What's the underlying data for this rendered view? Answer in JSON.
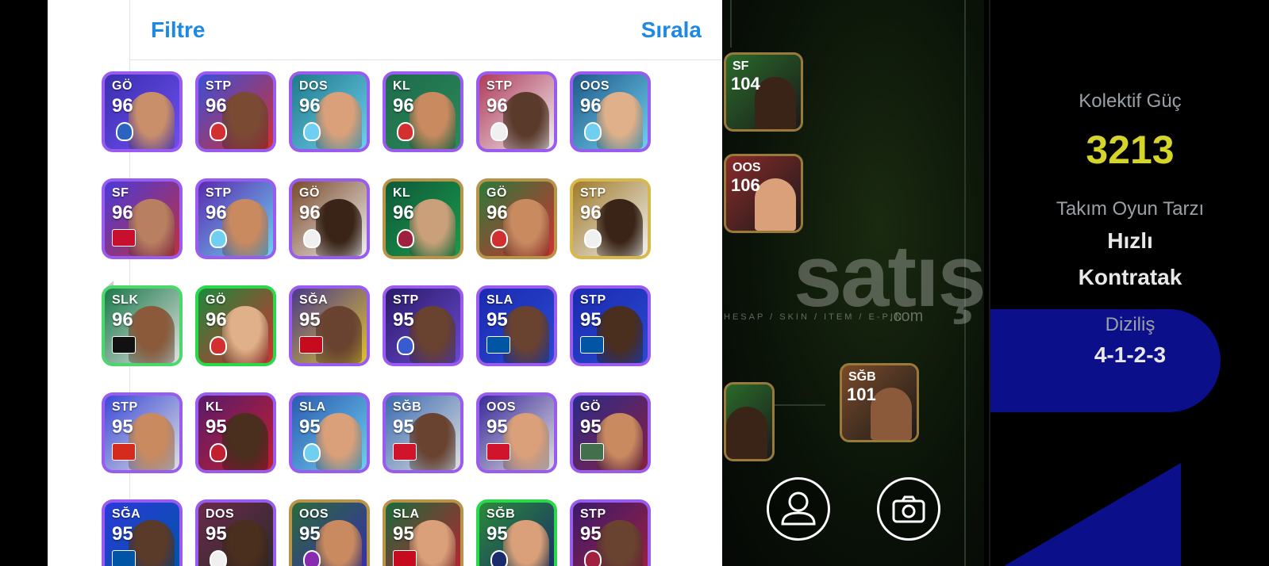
{
  "header": {
    "filter_label": "Filtre",
    "sort_label": "Sırala"
  },
  "cards": [
    {
      "pos": "GÖ",
      "rating": "96",
      "border": "#9a5cf0",
      "bg": "#3a2fb0",
      "accent": "#6f4ff0",
      "face": "#c98f6a",
      "badge": "club",
      "badge_color": "#2a64c0"
    },
    {
      "pos": "STP",
      "rating": "96",
      "border": "#9a5cf0",
      "bg": "#3b4fd8",
      "accent": "#d23030",
      "face": "#7a4a32",
      "badge": "club",
      "badge_color": "#d23030"
    },
    {
      "pos": "DOS",
      "rating": "96",
      "border": "#9a5cf0",
      "bg": "#1e7a8a",
      "accent": "#6fcff0",
      "face": "#d9a07a",
      "badge": "club",
      "badge_color": "#6fcff0"
    },
    {
      "pos": "KL",
      "rating": "96",
      "border": "#9a5cf0",
      "bg": "#1e6a4a",
      "accent": "#2a8a5a",
      "face": "#c98a60",
      "badge": "club",
      "badge_color": "#d23030"
    },
    {
      "pos": "STP",
      "rating": "96",
      "border": "#9a5cf0",
      "bg": "#b03a5a",
      "accent": "#f0f0f0",
      "face": "#5a3a2a",
      "badge": "club",
      "badge_color": "#f0f0f0"
    },
    {
      "pos": "OOS",
      "rating": "96",
      "border": "#9a5cf0",
      "bg": "#1e5a8a",
      "accent": "#6fcff0",
      "face": "#e0b08a",
      "badge": "club",
      "badge_color": "#6fcff0"
    },
    {
      "pos": "SF",
      "rating": "96",
      "border": "#9a5cf0",
      "bg": "#4a3ad8",
      "accent": "#c03040",
      "face": "#b88060",
      "badge": "flag",
      "badge_color": "#c8102e"
    },
    {
      "pos": "STP",
      "rating": "96",
      "border": "#9a5cf0",
      "bg": "#5a2ab0",
      "accent": "#6fcff0",
      "face": "#c98a60",
      "badge": "club",
      "badge_color": "#6fcff0"
    },
    {
      "pos": "GÖ",
      "rating": "96",
      "border": "#9a5cf0",
      "bg": "#7a4a2a",
      "accent": "#f0f0f0",
      "face": "#3a2418",
      "badge": "club",
      "badge_color": "#f0f0f0"
    },
    {
      "pos": "KL",
      "rating": "96",
      "border": "#b8944a",
      "bg": "#0e5a3a",
      "accent": "#1a9a4a",
      "face": "#caa07a",
      "badge": "club",
      "badge_color": "#a02040"
    },
    {
      "pos": "GÖ",
      "rating": "96",
      "border": "#b8944a",
      "bg": "#2a7a3a",
      "accent": "#d23030",
      "face": "#c98a60",
      "badge": "club",
      "badge_color": "#d23030"
    },
    {
      "pos": "STP",
      "rating": "96",
      "border": "#d8b84a",
      "bg": "#a07a2a",
      "accent": "#f0f0f0",
      "face": "#3a2418",
      "badge": "club",
      "badge_color": "#f0f0f0"
    },
    {
      "pos": "SLK",
      "rating": "96",
      "border": "#4ad86a",
      "bg": "#1a7a4a",
      "accent": "#e0e0e0",
      "face": "#8a5a3a",
      "badge": "flag",
      "badge_color": "#111111"
    },
    {
      "pos": "GÖ",
      "rating": "96",
      "border": "#2ad84a",
      "bg": "#1a8a3a",
      "accent": "#d23030",
      "face": "#e0b08a",
      "badge": "club",
      "badge_color": "#d23030"
    },
    {
      "pos": "SĞA",
      "rating": "95",
      "border": "#9a5cf0",
      "bg": "#4a3a8a",
      "accent": "#e0c030",
      "face": "#6a4230",
      "badge": "flag",
      "badge_color": "#c60b1e"
    },
    {
      "pos": "STP",
      "rating": "95",
      "border": "#9a5cf0",
      "bg": "#2a1a6a",
      "accent": "#6a4ad0",
      "face": "#6a4230",
      "badge": "club",
      "badge_color": "#3a5ad0"
    },
    {
      "pos": "SLA",
      "rating": "95",
      "border": "#9a5cf0",
      "bg": "#1a2ab0",
      "accent": "#2a4ad0",
      "face": "#6a4230",
      "badge": "flag",
      "badge_color": "#0055a4"
    },
    {
      "pos": "STP",
      "rating": "95",
      "border": "#9a5cf0",
      "bg": "#1a2ab0",
      "accent": "#2a4ad0",
      "face": "#4a2e1e",
      "badge": "flag",
      "badge_color": "#0055a4"
    },
    {
      "pos": "STP",
      "rating": "95",
      "border": "#9a5cf0",
      "bg": "#3a4ad8",
      "accent": "#e0e0e0",
      "face": "#c98a60",
      "badge": "flag",
      "badge_color": "#d52b1e"
    },
    {
      "pos": "KL",
      "rating": "95",
      "border": "#9a5cf0",
      "bg": "#5a1a6a",
      "accent": "#c02030",
      "face": "#4a2e1e",
      "badge": "club",
      "badge_color": "#c02030"
    },
    {
      "pos": "SLA",
      "rating": "95",
      "border": "#9a5cf0",
      "bg": "#2a5ab0",
      "accent": "#6fcff0",
      "face": "#d9a07a",
      "badge": "club",
      "badge_color": "#6fcff0"
    },
    {
      "pos": "SĞB",
      "rating": "95",
      "border": "#9a5cf0",
      "bg": "#3a6ab0",
      "accent": "#e0e0e0",
      "face": "#6a4230",
      "badge": "flag",
      "badge_color": "#cf142b"
    },
    {
      "pos": "OOS",
      "rating": "95",
      "border": "#9a5cf0",
      "bg": "#3a2a9a",
      "accent": "#e0e0e0",
      "face": "#d9a07a",
      "badge": "flag",
      "badge_color": "#cf142b"
    },
    {
      "pos": "GÖ",
      "rating": "95",
      "border": "#9a5cf0",
      "bg": "#2a2a8a",
      "accent": "#8a2040",
      "face": "#c98a60",
      "badge": "flag",
      "badge_color": "#436f4d"
    },
    {
      "pos": "SĞA",
      "rating": "95",
      "border": "#9a5cf0",
      "bg": "#2a3ad8",
      "accent": "#0055a4",
      "face": "#5a3a28",
      "badge": "flag",
      "badge_color": "#0055a4"
    },
    {
      "pos": "DOS",
      "rating": "95",
      "border": "#9a5cf0",
      "bg": "#6a2a4a",
      "accent": "#2a2a2a",
      "face": "#4a2e1e",
      "badge": "club",
      "badge_color": "#f0f0f0"
    },
    {
      "pos": "OOS",
      "rating": "95",
      "border": "#b8944a",
      "bg": "#2a6a3a",
      "accent": "#3a2ab0",
      "face": "#c98a60",
      "badge": "club",
      "badge_color": "#8a2ab0"
    },
    {
      "pos": "SLA",
      "rating": "95",
      "border": "#b8944a",
      "bg": "#1a6a3a",
      "accent": "#c02030",
      "face": "#d9a07a",
      "badge": "flag",
      "badge_color": "#c60b1e"
    },
    {
      "pos": "SĞB",
      "rating": "95",
      "border": "#2ad84a",
      "bg": "#2a8a3a",
      "accent": "#1a2a6a",
      "face": "#d9a07a",
      "badge": "club",
      "badge_color": "#1a2a6a"
    },
    {
      "pos": "STP",
      "rating": "95",
      "border": "#9a5cf0",
      "bg": "#3a1a6a",
      "accent": "#a02040",
      "face": "#6a4230",
      "badge": "club",
      "badge_color": "#a02040"
    }
  ],
  "field": {
    "players": [
      {
        "pos": "SF",
        "rating": "104",
        "bg": "#2a6a2a",
        "face": "#3a2418"
      },
      {
        "pos": "OOS",
        "rating": "106",
        "bg": "#8a2a2a",
        "face": "#d9a07a"
      },
      {
        "pos": "SĞB",
        "rating": "101",
        "bg": "#7a4a2a",
        "face": "#8a5a3a"
      },
      {
        "pos": "",
        "rating": "",
        "bg": "#2a6a2a",
        "face": "#3a2418"
      }
    ],
    "watermark": "satış",
    "watermark_sub": "HESAP / SKIN / ITEM / E-PIN",
    "watermark_com": ".com"
  },
  "info": {
    "strength_label": "Kolektif Güç",
    "strength_value": "3213",
    "style_label": "Takım Oyun Tarzı",
    "style_value_1": "Hızlı",
    "style_value_2": "Kontratak",
    "formation_label": "Diziliş",
    "formation_value": "4-1-2-3",
    "strength_color": "#d4d42a"
  }
}
